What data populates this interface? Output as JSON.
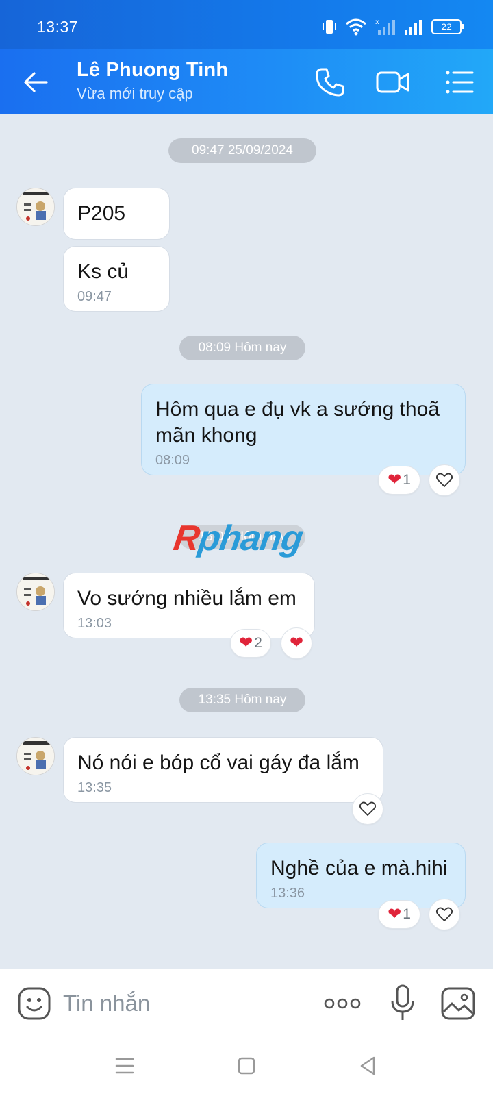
{
  "status_bar": {
    "time": "13:37",
    "battery": "22"
  },
  "header": {
    "contact_name": "Lê Phuong Tinh",
    "contact_status": "Vừa mới truy cập"
  },
  "messages": {
    "date_1": "09:47 25/09/2024",
    "m1_text": "P205",
    "m2_text": "Ks củ",
    "m2_time": "09:47",
    "date_2": "08:09 Hôm nay",
    "m3_text": "Hôm qua e đụ vk a sướng thoã mãn khong",
    "m3_time": "08:09",
    "m3_reaction_count": "1",
    "date_3": "13:03 Hôm nay",
    "m4_text": "Vo sướng nhiều lắm em",
    "m4_time": "13:03",
    "m4_reaction_count": "2",
    "date_4": "13:35 Hôm nay",
    "m5_text": "Nó nói e bóp cổ vai gáy đa lắm",
    "m5_time": "13:35",
    "m6_text": "Nghề của e mà.hihi",
    "m6_time": "13:36",
    "m6_reaction_count": "1"
  },
  "watermark": {
    "part_a": "R",
    "part_b": "phang"
  },
  "input_bar": {
    "placeholder": "Tin nhắn"
  },
  "colors": {
    "header_start": "#1a6ff0",
    "header_end": "#22a8f8",
    "chat_background": "#e2e9f1",
    "outgoing_bubble": "#d5ecfc",
    "incoming_bubble": "#ffffff",
    "heart": "#e0243a"
  },
  "icons": {
    "back": "arrow-left-icon",
    "call": "phone-icon",
    "video": "video-camera-icon",
    "menu": "list-menu-icon",
    "emoji": "smiley-icon",
    "more": "ellipsis-icon",
    "mic": "microphone-icon",
    "gallery": "image-icon"
  }
}
